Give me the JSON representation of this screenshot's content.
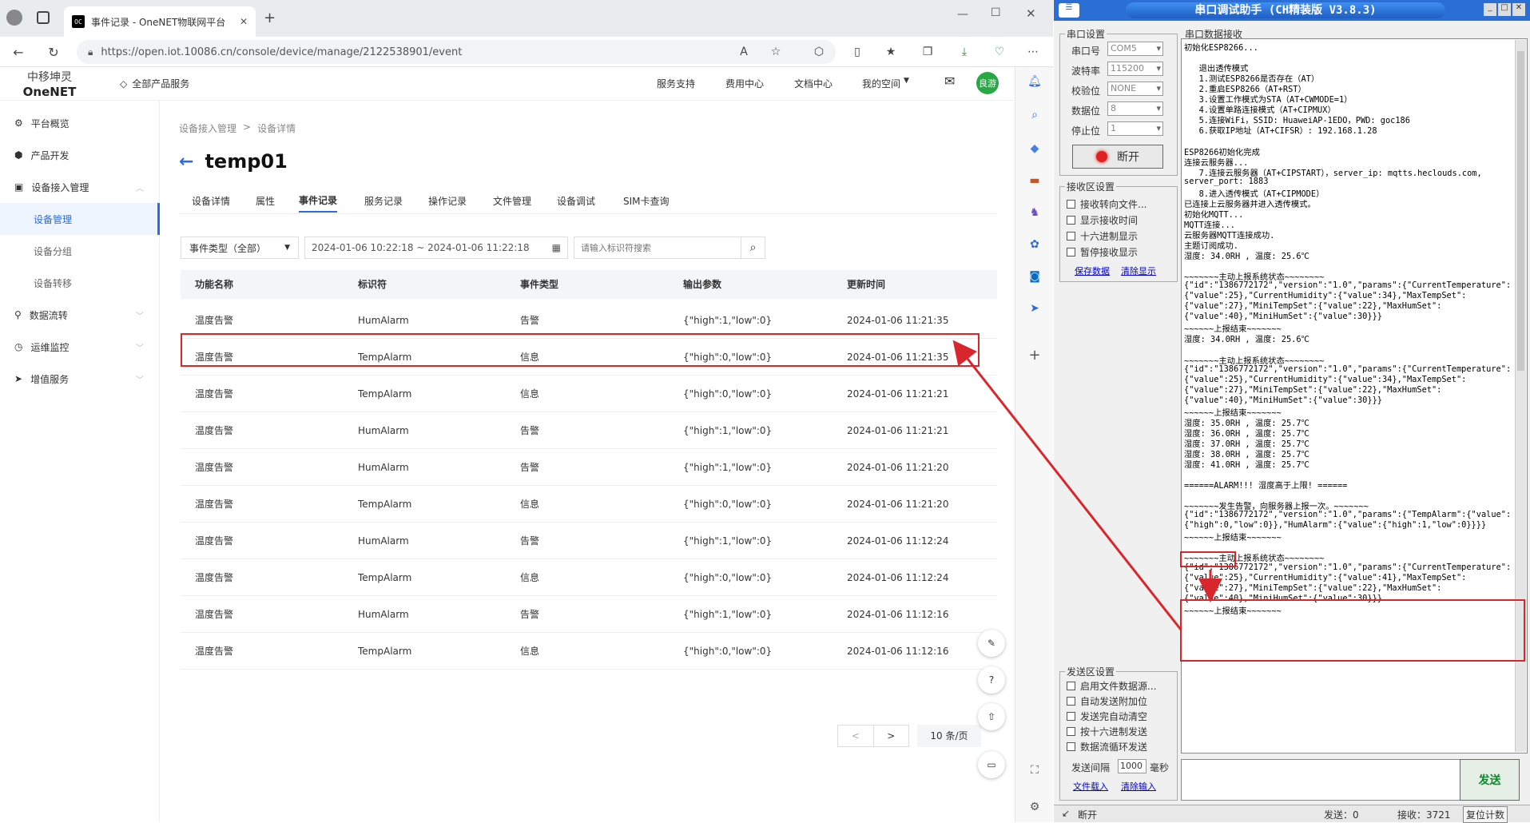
{
  "browser": {
    "tab_title": "事件记录 - OneNET物联网平台",
    "tab_favicon": "OC",
    "url": "https://open.iot.10086.cn/console/device/manage/2122538901/event"
  },
  "topnav": {
    "logo_line1": "中移坤灵",
    "logo_line2": "OneNET",
    "all_products": "全部产品服务",
    "links": [
      "服务支持",
      "费用中心",
      "文档中心",
      "我的空间"
    ],
    "avatar": "良游"
  },
  "sidebar": {
    "items": [
      {
        "label": "平台概览"
      },
      {
        "label": "产品开发"
      },
      {
        "label": "设备接入管理"
      },
      {
        "label": "设备管理"
      },
      {
        "label": "设备分组"
      },
      {
        "label": "设备转移"
      },
      {
        "label": "数据流转"
      },
      {
        "label": "运维监控"
      },
      {
        "label": "增值服务"
      }
    ]
  },
  "breadcrumb": {
    "first": "设备接入管理",
    "sep": ">",
    "second": "设备详情"
  },
  "page_title": "temp01",
  "tabs": [
    "设备详情",
    "属性",
    "事件记录",
    "服务记录",
    "操作记录",
    "文件管理",
    "设备调试",
    "SIM卡查询"
  ],
  "filter": {
    "event_type": "事件类型（全部）",
    "date_range": "2024-01-06 10:22:18 ~ 2024-01-06 11:22:18",
    "search_placeholder": "请输入标识符搜索"
  },
  "table": {
    "headers": [
      "功能名称",
      "标识符",
      "事件类型",
      "输出参数",
      "更新时间"
    ],
    "rows": [
      [
        "温度告警",
        "HumAlarm",
        "告警",
        "{\"high\":1,\"low\":0}",
        "2024-01-06 11:21:35"
      ],
      [
        "温度告警",
        "TempAlarm",
        "信息",
        "{\"high\":0,\"low\":0}",
        "2024-01-06 11:21:35"
      ],
      [
        "温度告警",
        "TempAlarm",
        "信息",
        "{\"high\":0,\"low\":0}",
        "2024-01-06 11:21:21"
      ],
      [
        "温度告警",
        "HumAlarm",
        "告警",
        "{\"high\":1,\"low\":0}",
        "2024-01-06 11:21:21"
      ],
      [
        "温度告警",
        "HumAlarm",
        "告警",
        "{\"high\":1,\"low\":0}",
        "2024-01-06 11:21:20"
      ],
      [
        "温度告警",
        "TempAlarm",
        "信息",
        "{\"high\":0,\"low\":0}",
        "2024-01-06 11:21:20"
      ],
      [
        "温度告警",
        "HumAlarm",
        "告警",
        "{\"high\":1,\"low\":0}",
        "2024-01-06 11:12:24"
      ],
      [
        "温度告警",
        "TempAlarm",
        "信息",
        "{\"high\":0,\"low\":0}",
        "2024-01-06 11:12:24"
      ],
      [
        "温度告警",
        "HumAlarm",
        "告警",
        "{\"high\":1,\"low\":0}",
        "2024-01-06 11:12:16"
      ],
      [
        "温度告警",
        "TempAlarm",
        "信息",
        "{\"high\":0,\"low\":0}",
        "2024-01-06 11:12:16"
      ]
    ]
  },
  "pagination": {
    "prev": "<",
    "next": ">",
    "page_size": "10 条/页"
  },
  "serial": {
    "title": "串口调试助手 (CH精装版 V3.8.3)",
    "port_group": "串口设置",
    "port_label": "串口号",
    "port_value": "COM5",
    "baud_label": "波特率",
    "baud_value": "115200",
    "parity_label": "校验位",
    "parity_value": "NONE",
    "databits_label": "数据位",
    "databits_value": "8",
    "stopbits_label": "停止位",
    "stopbits_value": "1",
    "disconnect_button": "断开",
    "recv_group": "接收区设置",
    "recv_options": [
      "接收转向文件...",
      "显示接收时间",
      "十六进制显示",
      "暂停接收显示"
    ],
    "save_data": "保存数据",
    "clear_display": "清除显示",
    "recv_title": "串口数据接收",
    "send_group": "发送区设置",
    "send_options": [
      "启用文件数据源...",
      "自动发送附加位",
      "发送完自动清空",
      "按十六进制发送",
      "数据流循环发送"
    ],
    "interval_label": "发送间隔",
    "interval_value": "1000",
    "interval_unit": "毫秒",
    "file_load": "文件载入",
    "clear_input": "清除输入",
    "send_button": "发送",
    "status_state": "断开",
    "status_sent": "发送：0",
    "status_recv": "接收：3721",
    "status_reset": "复位计数",
    "recv_lines": [
      "初始化ESP8266...",
      "",
      "   退出透传模式",
      "   1.测试ESP8266是否存在（AT）",
      "   2.重启ESP8266（AT+RST）",
      "   3.设置工作模式为STA（AT+CWMODE=1）",
      "   4.设置单路连接模式（AT+CIPMUX）",
      "   5.连接WiFi，SSID: HuaweiAP-1EDO，PWD: goc186",
      "   6.获取IP地址（AT+CIFSR）: 192.168.1.28",
      "",
      "ESP8266初始化完成",
      "连接云服务器...",
      "   7.连接云服务器（AT+CIPSTART），server_ip: mqtts.heclouds.com,",
      "server_port: 1883",
      "   8.进入透传模式（AT+CIPMODE）",
      "已连接上云服务器并进入透传模式。",
      "初始化MQTT...",
      "MQTT连接...",
      "云服务器MQTT连接成功.",
      "主题订阅成功.",
      "湿度: 34.0RH , 温度: 25.6℃",
      "",
      "~~~~~~~主动上报系统状态~~~~~~~~",
      "{\"id\":\"1386772172\",\"version\":\"1.0\",\"params\":{\"CurrentTemperature\":",
      "{\"value\":25},\"CurrentHumidity\":{\"value\":34},\"MaxTempSet\":",
      "{\"value\":27},\"MiniTempSet\":{\"value\":22},\"MaxHumSet\":",
      "{\"value\":40},\"MiniHumSet\":{\"value\":30}}}",
      "~~~~~~上报结束~~~~~~~",
      "湿度: 34.0RH , 温度: 25.6℃",
      "",
      "~~~~~~~主动上报系统状态~~~~~~~~",
      "{\"id\":\"1386772172\",\"version\":\"1.0\",\"params\":{\"CurrentTemperature\":",
      "{\"value\":25},\"CurrentHumidity\":{\"value\":34},\"MaxTempSet\":",
      "{\"value\":27},\"MiniTempSet\":{\"value\":22},\"MaxHumSet\":",
      "{\"value\":40},\"MiniHumSet\":{\"value\":30}}}",
      "~~~~~~上报结束~~~~~~~",
      "湿度: 35.0RH , 温度: 25.7℃",
      "湿度: 36.0RH , 温度: 25.7℃",
      "湿度: 37.0RH , 温度: 25.7℃",
      "湿度: 38.0RH , 温度: 25.7℃",
      "湿度: 41.0RH , 温度: 25.7℃",
      "",
      "======ALARM!!! 湿度高于上限! ======",
      "",
      "~~~~~~~发生告警，向服务器上报一次。~~~~~~~",
      "{\"id\":\"1386772172\",\"version\":\"1.0\",\"params\":{\"TempAlarm\":{\"value\":",
      "{\"high\":0,\"low\":0}},\"HumAlarm\":{\"value\":{\"high\":1,\"low\":0}}}}",
      "~~~~~~上报结束~~~~~~~",
      "",
      "~~~~~~~主动上报系统状态~~~~~~~~",
      "{\"id\":\"1386772172\",\"version\":\"1.0\",\"params\":{\"CurrentTemperature\":",
      "{\"value\":25},\"CurrentHumidity\":{\"value\":41},\"MaxTempSet\":",
      "{\"value\":27},\"MiniTempSet\":{\"value\":22},\"MaxHumSet\":",
      "{\"value\":40},\"MiniHumSet\":{\"value\":30}}}",
      "~~~~~~上报结束~~~~~~~"
    ]
  },
  "colors": {
    "accent": "#2d6cdf",
    "annotation": "#d9262c",
    "serial_title": "#2b6fd6"
  }
}
